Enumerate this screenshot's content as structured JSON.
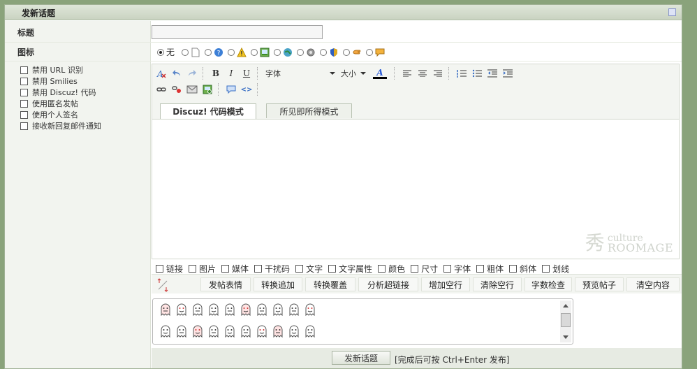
{
  "header": {
    "title": "发新话题"
  },
  "labels": {
    "subject": "标题",
    "icon": "图标"
  },
  "subject": {
    "value": "",
    "placeholder": ""
  },
  "post_icons": {
    "none_label": "无",
    "selected": "none",
    "icons": [
      "page-icon",
      "help-icon",
      "warning-icon",
      "image-icon",
      "globe-icon",
      "gear-icon",
      "shield-icon",
      "hand-icon",
      "comment-icon"
    ]
  },
  "options": [
    "禁用 URL 识别",
    "禁用 Smilies",
    "禁用 Discuz! 代码",
    "使用匿名发帖",
    "使用个人签名",
    "接收新回复邮件通知"
  ],
  "toolbar": {
    "font_label": "字体",
    "size_label": "大小",
    "bold": "B",
    "italic": "I",
    "underline": "U",
    "color_icon_letter": "A",
    "source_label": "<>"
  },
  "editor_tabs": {
    "code_mode": "Discuz! 代码模式",
    "wysiwyg_mode": "所见即所得模式",
    "active": "code_mode"
  },
  "watermark": {
    "logo": "秀",
    "line1": "culture",
    "line2": "ROOMAGE"
  },
  "code_options": [
    "链接",
    "图片",
    "媒体",
    "干扰码",
    "文字",
    "文字属性",
    "颜色",
    "尺寸",
    "字体",
    "粗体",
    "斜体",
    "划线"
  ],
  "actions": [
    "发帖表情",
    "转换追加",
    "转换覆盖",
    "分析超链接",
    "增加空行",
    "清除空行",
    "字数检查",
    "预览帖子",
    "清空内容"
  ],
  "smilies": {
    "rows": 2,
    "per_row": 10
  },
  "submit": {
    "label": "发新话题",
    "hint": "[完成后可按 Ctrl+Enter 发布]"
  }
}
